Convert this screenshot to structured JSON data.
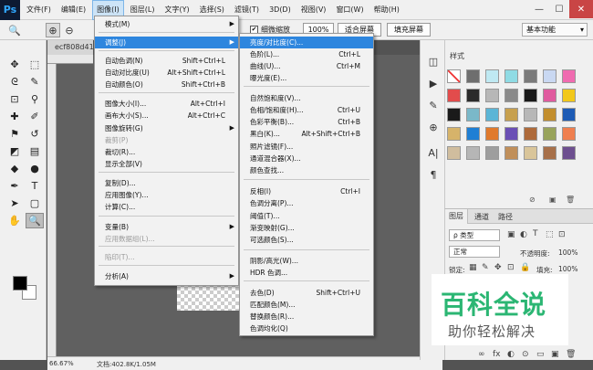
{
  "app": {
    "logo": "Ps"
  },
  "menubar": [
    "文件(F)",
    "编辑(E)",
    "图像(I)",
    "图层(L)",
    "文字(Y)",
    "选择(S)",
    "滤镜(T)",
    "3D(D)",
    "视图(V)",
    "窗口(W)",
    "帮助(H)"
  ],
  "window_buttons": [
    "—",
    "☐",
    "✕"
  ],
  "options": {
    "checkbox_mark": "✔",
    "scrubby_zoom": "细微缩放",
    "zoom_100": "100%",
    "fit_screen": "适合屏幕",
    "fill_screen": "填充屏幕",
    "workspace": "基本功能"
  },
  "document": {
    "tab": "ecf808d419",
    "zoom": "66.67%",
    "doc_info": "文档:402.8K/1.05M"
  },
  "image_menu": [
    {
      "label": "模式(M)",
      "shortcut": "",
      "submenu": true
    },
    {
      "label": "调整(J)",
      "shortcut": "",
      "submenu": true,
      "highlighted": true
    },
    {
      "label": "自动色调(N)",
      "shortcut": "Shift+Ctrl+L"
    },
    {
      "label": "自动对比度(U)",
      "shortcut": "Alt+Shift+Ctrl+L"
    },
    {
      "label": "自动颜色(O)",
      "shortcut": "Shift+Ctrl+B"
    },
    {
      "label": "图像大小(I)...",
      "shortcut": "Alt+Ctrl+I"
    },
    {
      "label": "画布大小(S)...",
      "shortcut": "Alt+Ctrl+C"
    },
    {
      "label": "图像旋转(G)",
      "shortcut": "",
      "submenu": true
    },
    {
      "label": "裁剪(P)",
      "shortcut": "",
      "disabled": true
    },
    {
      "label": "裁切(R)...",
      "shortcut": ""
    },
    {
      "label": "显示全部(V)",
      "shortcut": ""
    },
    {
      "label": "复制(D)...",
      "shortcut": ""
    },
    {
      "label": "应用图像(Y)...",
      "shortcut": ""
    },
    {
      "label": "计算(C)...",
      "shortcut": ""
    },
    {
      "label": "变量(B)",
      "shortcut": "",
      "submenu": true
    },
    {
      "label": "应用数据组(L)...",
      "shortcut": "",
      "disabled": true
    },
    {
      "label": "陷印(T)...",
      "shortcut": "",
      "disabled": true
    },
    {
      "label": "分析(A)",
      "shortcut": "",
      "submenu": true
    }
  ],
  "adjust_menu": [
    {
      "label": "亮度/对比度(C)...",
      "shortcut": "",
      "highlighted": true
    },
    {
      "label": "色阶(L)...",
      "shortcut": "Ctrl+L"
    },
    {
      "label": "曲线(U)...",
      "shortcut": "Ctrl+M"
    },
    {
      "label": "曝光度(E)...",
      "shortcut": ""
    },
    {
      "label": "自然饱和度(V)...",
      "shortcut": ""
    },
    {
      "label": "色相/饱和度(H)...",
      "shortcut": "Ctrl+U"
    },
    {
      "label": "色彩平衡(B)...",
      "shortcut": "Ctrl+B"
    },
    {
      "label": "黑白(K)...",
      "shortcut": "Alt+Shift+Ctrl+B"
    },
    {
      "label": "照片滤镜(F)...",
      "shortcut": ""
    },
    {
      "label": "通道混合器(X)...",
      "shortcut": ""
    },
    {
      "label": "颜色查找...",
      "shortcut": ""
    },
    {
      "label": "反相(I)",
      "shortcut": "Ctrl+I"
    },
    {
      "label": "色调分离(P)...",
      "shortcut": ""
    },
    {
      "label": "阈值(T)...",
      "shortcut": ""
    },
    {
      "label": "渐变映射(G)...",
      "shortcut": ""
    },
    {
      "label": "可选颜色(S)...",
      "shortcut": ""
    },
    {
      "label": "阴影/高光(W)...",
      "shortcut": ""
    },
    {
      "label": "HDR 色调...",
      "shortcut": ""
    },
    {
      "label": "去色(D)",
      "shortcut": "Shift+Ctrl+U"
    },
    {
      "label": "匹配颜色(M)...",
      "shortcut": ""
    },
    {
      "label": "替换颜色(R)...",
      "shortcut": ""
    },
    {
      "label": "色调均化(Q)",
      "shortcut": ""
    }
  ],
  "styles_panel": {
    "tab": "样式"
  },
  "layers_panel": {
    "tabs": [
      "图层",
      "通道",
      "路径"
    ],
    "filter": "ρ 类型",
    "blend_mode": "正常",
    "opacity_label": "不透明度:",
    "opacity": "100%",
    "lock_label": "锁定:",
    "fill_label": "填充:",
    "fill": "100%",
    "footer_icons": [
      "link-icon",
      "fx-icon",
      "mask-icon",
      "adjustment-icon",
      "group-icon",
      "new-layer-icon",
      "delete-icon"
    ],
    "footer_glyphs": [
      "∞",
      "fx",
      "◐",
      "⊙",
      "▭",
      "▣",
      "🗑"
    ]
  },
  "watermark": {
    "main": "百科全说",
    "sub": "助你轻松解决"
  },
  "tools": [
    {
      "name": "move-tool-icon",
      "glyph": "✥"
    },
    {
      "name": "marquee-tool-icon",
      "glyph": "⬚"
    },
    {
      "name": "lasso-tool-icon",
      "glyph": "ᘓ"
    },
    {
      "name": "quick-select-tool-icon",
      "glyph": "✎"
    },
    {
      "name": "crop-tool-icon",
      "glyph": "⊡"
    },
    {
      "name": "eyedropper-tool-icon",
      "glyph": "⚲"
    },
    {
      "name": "healing-tool-icon",
      "glyph": "✚"
    },
    {
      "name": "brush-tool-icon",
      "glyph": "✐"
    },
    {
      "name": "stamp-tool-icon",
      "glyph": "⚑"
    },
    {
      "name": "history-brush-icon",
      "glyph": "↺"
    },
    {
      "name": "eraser-tool-icon",
      "glyph": "◩"
    },
    {
      "name": "gradient-tool-icon",
      "glyph": "▤"
    },
    {
      "name": "blur-tool-icon",
      "glyph": "◆"
    },
    {
      "name": "dodge-tool-icon",
      "glyph": "●"
    },
    {
      "name": "pen-tool-icon",
      "glyph": "✒"
    },
    {
      "name": "type-tool-icon",
      "glyph": "T"
    },
    {
      "name": "path-select-tool-icon",
      "glyph": "➤"
    },
    {
      "name": "shape-tool-icon",
      "glyph": "▢"
    },
    {
      "name": "hand-tool-icon",
      "glyph": "✋"
    },
    {
      "name": "zoom-tool-icon",
      "glyph": "🔍"
    }
  ]
}
